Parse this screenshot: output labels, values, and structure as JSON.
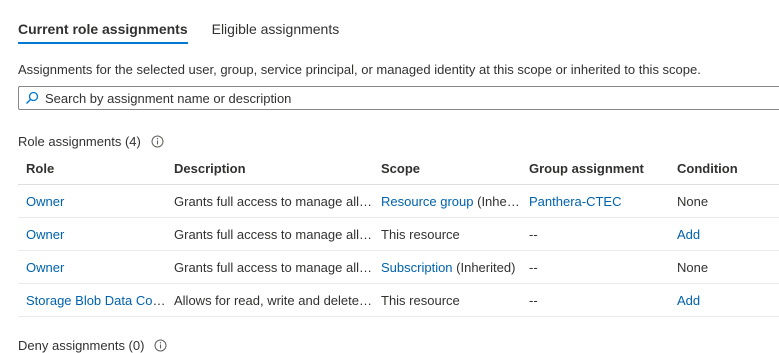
{
  "tabs": [
    {
      "label": "Current role assignments",
      "active": true
    },
    {
      "label": "Eligible assignments",
      "active": false
    }
  ],
  "subtitle": "Assignments for the selected user, group, service principal, or managed identity at this scope or inherited to this scope.",
  "search": {
    "placeholder": "Search by assignment name or description"
  },
  "role_section": {
    "title": "Role assignments (4)"
  },
  "table": {
    "headers": [
      "Role",
      "Description",
      "Scope",
      "Group assignment",
      "Condition"
    ],
    "rows": [
      {
        "role": "Owner",
        "description": "Grants full access to manage all r...",
        "scope_link": "Resource group",
        "scope_text": " (Inher...",
        "group": "Panthera-CTEC",
        "group_is_link": true,
        "condition": "None",
        "condition_is_link": false
      },
      {
        "role": "Owner",
        "description": "Grants full access to manage all r...",
        "scope_link": "",
        "scope_text": "This resource",
        "group": "--",
        "group_is_link": false,
        "condition": "Add",
        "condition_is_link": true
      },
      {
        "role": "Owner",
        "description": "Grants full access to manage all r...",
        "scope_link": "Subscription",
        "scope_text": " (Inherited)",
        "group": "--",
        "group_is_link": false,
        "condition": "None",
        "condition_is_link": false
      },
      {
        "role": "Storage Blob Data Contr",
        "description": "Allows for read, write and delete ...",
        "scope_link": "",
        "scope_text": "This resource",
        "group": "--",
        "group_is_link": false,
        "condition": "Add",
        "condition_is_link": true
      }
    ]
  },
  "deny_section": {
    "title": "Deny assignments (0)"
  },
  "colors": {
    "accent": "#0078d4",
    "link": "#0062ad",
    "text": "#323130"
  }
}
